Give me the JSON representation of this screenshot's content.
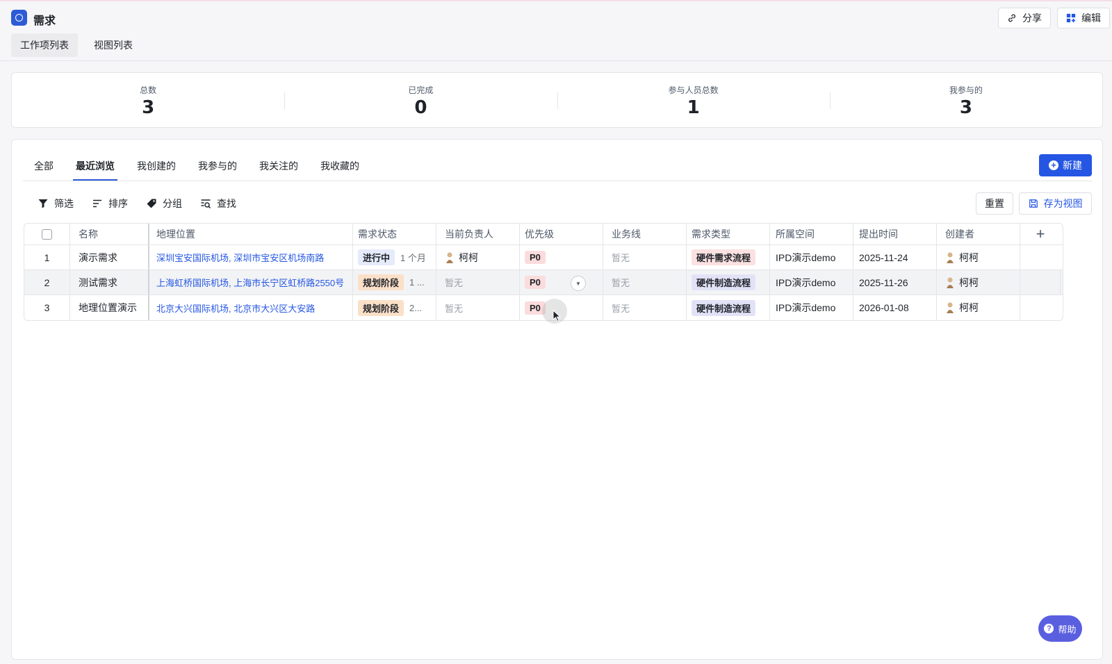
{
  "app": {
    "title": "需求",
    "share_label": "分享",
    "edit_label": "编辑"
  },
  "view_tabs": [
    {
      "label": "工作项列表",
      "active": true
    },
    {
      "label": "视图列表",
      "active": false
    }
  ],
  "stats": [
    {
      "label": "总数",
      "value": "3"
    },
    {
      "label": "已完成",
      "value": "0"
    },
    {
      "label": "参与人员总数",
      "value": "1"
    },
    {
      "label": "我参与的",
      "value": "3"
    }
  ],
  "filter_tabs": [
    {
      "label": "全部",
      "active": false
    },
    {
      "label": "最近浏览",
      "active": true
    },
    {
      "label": "我创建的",
      "active": false
    },
    {
      "label": "我参与的",
      "active": false
    },
    {
      "label": "我关注的",
      "active": false
    },
    {
      "label": "我收藏的",
      "active": false
    }
  ],
  "new_button_label": "新建",
  "toolbar": {
    "filter": "筛选",
    "sort": "排序",
    "group": "分组",
    "find": "查找",
    "reset": "重置",
    "save_view": "存为视图"
  },
  "table": {
    "headers": [
      "名称",
      "地理位置",
      "需求状态",
      "当前负责人",
      "优先级",
      "业务线",
      "需求类型",
      "所属空间",
      "提出时间",
      "创建者"
    ],
    "add_column_symbol": "+",
    "rows": [
      {
        "index": "1",
        "name": "演示需求",
        "location": "深圳宝安国际机场, 深圳市宝安区机场南路",
        "status": "进行中",
        "status_extra": "1 个月",
        "owner": "柯柯",
        "priority": "P0",
        "business": "暂无",
        "type": "硬件需求流程",
        "space": "IPD演示demo",
        "time": "2025-11-24",
        "creator": "柯柯"
      },
      {
        "index": "2",
        "name": "测试需求",
        "location": "上海虹桥国际机场, 上海市长宁区虹桥路2550号",
        "status": "规划阶段",
        "status_extra": "1 ...",
        "owner": "暂无",
        "priority": "P0",
        "business": "暂无",
        "type": "硬件制造流程",
        "space": "IPD演示demo",
        "time": "2025-11-26",
        "creator": "柯柯"
      },
      {
        "index": "3",
        "name": "地理位置演示",
        "location": "北京大兴国际机场, 北京市大兴区大安路",
        "status": "规划阶段",
        "status_extra": "2...",
        "owner": "暂无",
        "priority": "P0",
        "business": "暂无",
        "type": "硬件制造流程",
        "space": "IPD演示demo",
        "time": "2026-01-08",
        "creator": "柯柯"
      }
    ]
  },
  "help_label": "帮助",
  "colors": {
    "accent": "#2456e3",
    "help": "#5a5fe0"
  }
}
